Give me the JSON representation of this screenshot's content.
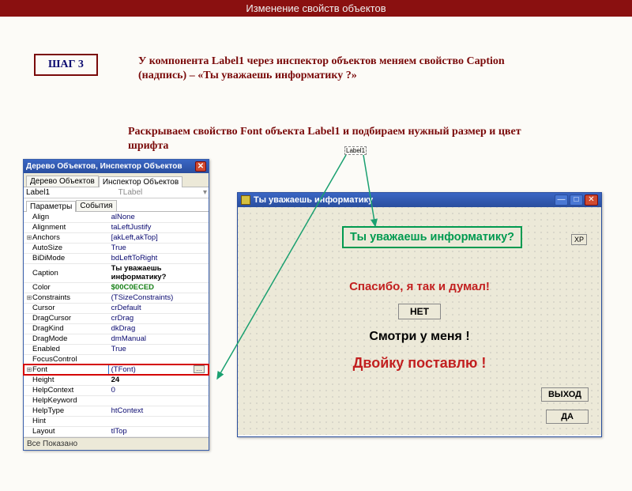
{
  "page_title": "Изменение свойств объектов",
  "step_label": "ШАГ 3",
  "para1": "У компонента Label1 через инспектор объектов меняем свойство Caption (надпись) – «Ты уважаешь информатику ?»",
  "para2": "Раскрываем свойство Font объекта Label1 и подбираем нужный размер и цвет шрифта",
  "inspector": {
    "title": "Дерево Объектов, Инспектор Объектов",
    "tab_tree": "Дерево Объектов",
    "tab_insp": "Инспектор Объектов",
    "obj_name": "Label1",
    "obj_type": "TLabel",
    "tab_params": "Параметры",
    "tab_events": "События",
    "footer": "Все Показано",
    "props": {
      "Align": "alNone",
      "Alignment": "taLeftJustify",
      "Anchors": "[akLeft,akTop]",
      "AutoSize": "True",
      "BiDiMode": "bdLeftToRight",
      "Caption": "Ты уважаешь информатику?",
      "Color": "$00C0ECED",
      "Constraints": "(TSizeConstraints)",
      "Cursor": "crDefault",
      "DragCursor": "crDrag",
      "DragKind": "dkDrag",
      "DragMode": "dmManual",
      "Enabled": "True",
      "FocusControl": "",
      "Font": "(TFont)",
      "Height": "24",
      "HelpContext": "0",
      "HelpKeyword": "",
      "HelpType": "htContext",
      "Hint": "",
      "Layout": "tlTop"
    }
  },
  "form": {
    "title": "Ты уважаешь информатику",
    "label1": "Ты уважаешь информатику?",
    "xp": "XP",
    "msg1": "Спасибо, я так и думал!",
    "btn_no": "НЕТ",
    "msg2": "Смотри у меня !",
    "msg3": "Двойку поставлю !",
    "btn_exit": "ВЫХОД",
    "btn_yes": "ДА"
  },
  "label1_tag": "Label1",
  "icons": {
    "close_x": "✕",
    "min": "—",
    "max": "□",
    "dd": "▾"
  }
}
